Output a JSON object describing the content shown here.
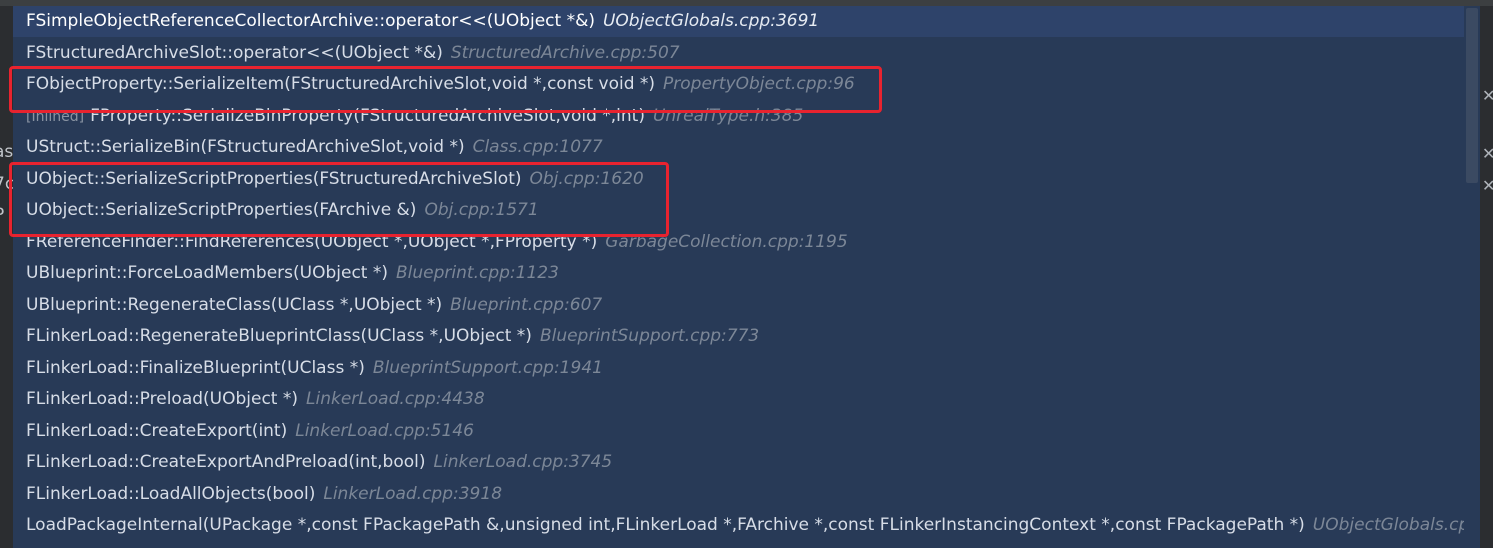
{
  "left_fragments": [
    "as",
    "7c",
    "P"
  ],
  "frames": [
    {
      "tag": "",
      "func": "FSimpleObjectReferenceCollectorArchive::operator<<(UObject *&)",
      "file": "UObjectGlobals.cpp:3691"
    },
    {
      "tag": "",
      "func": "FStructuredArchiveSlot::operator<<(UObject *&)",
      "file": "StructuredArchive.cpp:507"
    },
    {
      "tag": "",
      "func": "FObjectProperty::SerializeItem(FStructuredArchiveSlot,void *,const void *)",
      "file": "PropertyObject.cpp:96"
    },
    {
      "tag": "[Inlined]",
      "func": "FProperty::SerializeBinProperty(FStructuredArchiveSlot,void *,int)",
      "file": "UnrealType.h:385"
    },
    {
      "tag": "",
      "func": "UStruct::SerializeBin(FStructuredArchiveSlot,void *)",
      "file": "Class.cpp:1077"
    },
    {
      "tag": "",
      "func": "UObject::SerializeScriptProperties(FStructuredArchiveSlot)",
      "file": "Obj.cpp:1620"
    },
    {
      "tag": "",
      "func": "UObject::SerializeScriptProperties(FArchive &)",
      "file": "Obj.cpp:1571"
    },
    {
      "tag": "",
      "func": "FReferenceFinder::FindReferences(UObject *,UObject *,FProperty *)",
      "file": "GarbageCollection.cpp:1195"
    },
    {
      "tag": "",
      "func": "UBlueprint::ForceLoadMembers(UObject *)",
      "file": "Blueprint.cpp:1123"
    },
    {
      "tag": "",
      "func": "UBlueprint::RegenerateClass(UClass *,UObject *)",
      "file": "Blueprint.cpp:607"
    },
    {
      "tag": "",
      "func": "FLinkerLoad::RegenerateBlueprintClass(UClass *,UObject *)",
      "file": "BlueprintSupport.cpp:773"
    },
    {
      "tag": "",
      "func": "FLinkerLoad::FinalizeBlueprint(UClass *)",
      "file": "BlueprintSupport.cpp:1941"
    },
    {
      "tag": "",
      "func": "FLinkerLoad::Preload(UObject *)",
      "file": "LinkerLoad.cpp:4438"
    },
    {
      "tag": "",
      "func": "FLinkerLoad::CreateExport(int)",
      "file": "LinkerLoad.cpp:5146"
    },
    {
      "tag": "",
      "func": "FLinkerLoad::CreateExportAndPreload(int,bool)",
      "file": "LinkerLoad.cpp:3745"
    },
    {
      "tag": "",
      "func": "FLinkerLoad::LoadAllObjects(bool)",
      "file": "LinkerLoad.cpp:3918"
    },
    {
      "tag": "",
      "func": "LoadPackageInternal(UPackage *,const FPackagePath &,unsigned int,FLinkerLoad *,FArchive *,const FLinkerInstancingContext *,const FPackagePath *)",
      "file": "UObjectGlobals.cpp:"
    }
  ],
  "colors": {
    "highlight": "#e8232f",
    "popup_bg": "#283a57",
    "selected_bg": "#2e436a"
  }
}
